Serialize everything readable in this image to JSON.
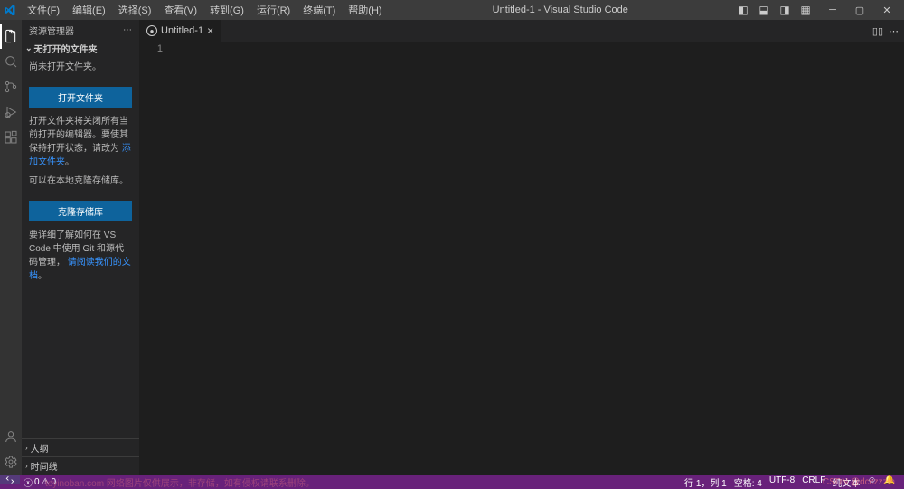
{
  "titlebar": {
    "menu": [
      "文件(F)",
      "编辑(E)",
      "选择(S)",
      "查看(V)",
      "转到(G)",
      "运行(R)",
      "终端(T)",
      "帮助(H)"
    ],
    "title": "Untitled-1 - Visual Studio Code"
  },
  "sidebar": {
    "header": "资源管理器",
    "section_title": "无打开的文件夹",
    "no_folder_text": "尚未打开文件夹。",
    "open_folder_btn": "打开文件夹",
    "open_folder_desc_a": "打开文件夹将关闭所有当前打开的编辑器。要使其保持打开状态，请改为",
    "open_folder_link": "添加文件夹",
    "open_folder_desc_b": "。",
    "clone_desc": "可以在本地克隆存储库。",
    "clone_btn": "克隆存储库",
    "learn_desc_a": "要详细了解如何在 VS Code 中使用 Git 和源代码管理，",
    "learn_link": "请阅读我们的文档",
    "learn_desc_b": "。",
    "outline": "大纲",
    "timeline": "时间线"
  },
  "tab": {
    "name": "Untitled-1"
  },
  "editor": {
    "line_number": "1"
  },
  "statusbar": {
    "errors": "0",
    "warnings": "0",
    "line_col": "行 1，列 1",
    "spaces": "空格: 4",
    "encoding": "UTF-8",
    "eol": "CRLF",
    "lang": "纯文本",
    "feedback": "☺"
  },
  "watermark": {
    "left": "toyinoban.com 网络图片仅供展示，非存储，如有侵权请联系删除。",
    "right": "CSDN @dcczzzm"
  }
}
